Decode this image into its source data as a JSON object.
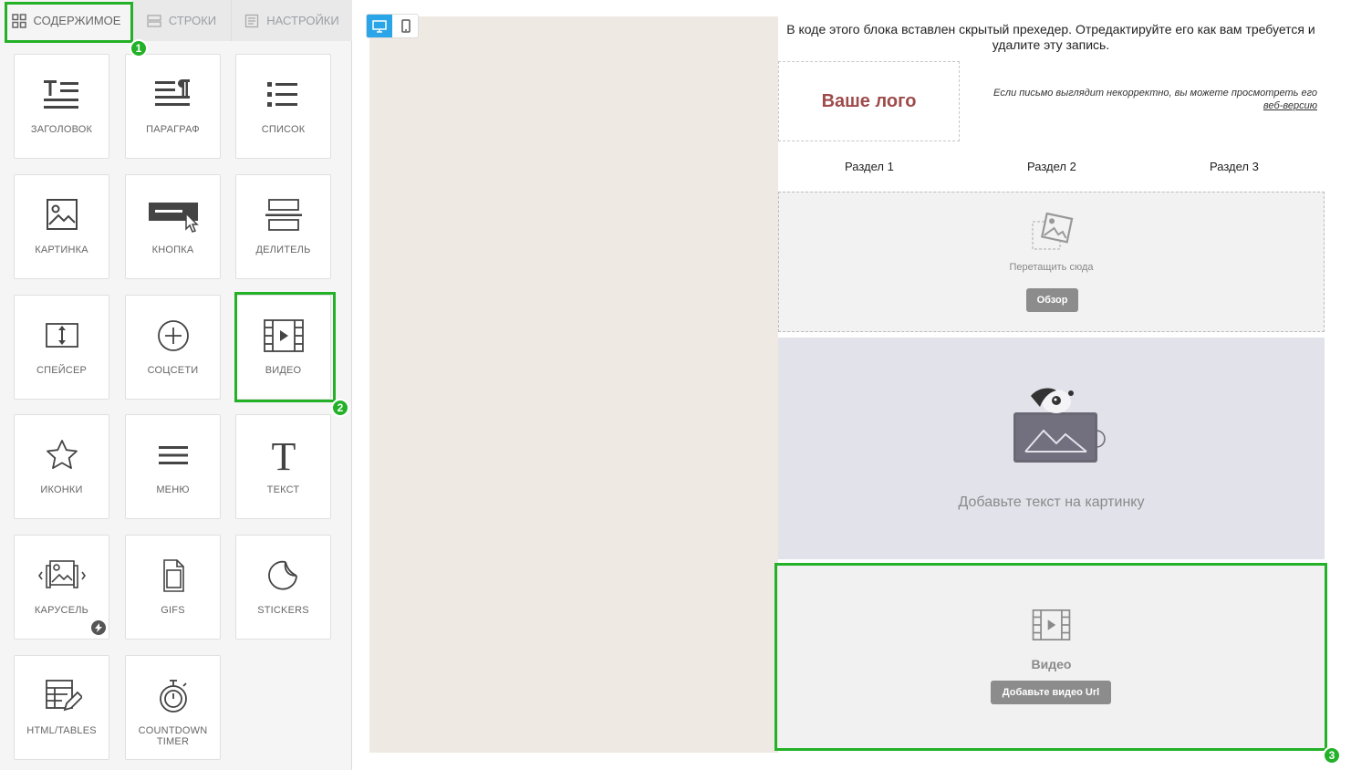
{
  "tabs": [
    {
      "label": "СОДЕРЖИМОЕ",
      "icon": "grid-icon",
      "active": true
    },
    {
      "label": "СТРОКИ",
      "icon": "rows-icon",
      "active": false
    },
    {
      "label": "НАСТРОЙКИ",
      "icon": "settings-icon",
      "active": false
    }
  ],
  "tiles": [
    {
      "label": "ЗАГОЛОВОК",
      "icon": "title-icon"
    },
    {
      "label": "ПАРАГРАФ",
      "icon": "paragraph-icon"
    },
    {
      "label": "СПИСОК",
      "icon": "list-icon"
    },
    {
      "label": "КАРТИНКА",
      "icon": "image-icon"
    },
    {
      "label": "КНОПКА",
      "icon": "button-icon"
    },
    {
      "label": "ДЕЛИТЕЛЬ",
      "icon": "divider-icon"
    },
    {
      "label": "СПЕЙСЕР",
      "icon": "spacer-icon"
    },
    {
      "label": "СОЦСЕТИ",
      "icon": "social-icon"
    },
    {
      "label": "ВИДЕО",
      "icon": "video-icon"
    },
    {
      "label": "ИКОНКИ",
      "icon": "star-icon"
    },
    {
      "label": "МЕНЮ",
      "icon": "menu-icon"
    },
    {
      "label": "ТЕКСТ",
      "icon": "text-icon"
    },
    {
      "label": "КАРУСЕЛЬ",
      "icon": "carousel-icon"
    },
    {
      "label": "GIFS",
      "icon": "gif-icon"
    },
    {
      "label": "STICKERS",
      "icon": "sticker-icon"
    },
    {
      "label": "HTML/TABLES",
      "icon": "html-tables-icon"
    },
    {
      "label": "COUNTDOWN TIMER",
      "icon": "timer-icon"
    }
  ],
  "annotations": [
    "1",
    "2",
    "3"
  ],
  "annotation_color": "#23b128",
  "device_toggle": {
    "active": "desktop",
    "options": [
      "desktop-icon",
      "mobile-icon"
    ],
    "accent": "#2aa6e8"
  },
  "email": {
    "preheader": "В коде этого блока вставлен скрытый прехедер. Отредактируйте его как вам требуется и удалите эту запись.",
    "logo": "Ваше лого",
    "webversion_text": "Если письмо выглядит некорректно, вы можете просмотреть его",
    "webversion_link": "веб-версию",
    "nav": [
      "Раздел 1",
      "Раздел 2",
      "Раздел 3"
    ],
    "image_drop": {
      "text": "Перетащить сюда",
      "button": "Обзор"
    },
    "bg_image_text": "Добавьте текст на картинку",
    "video": {
      "title": "Видео",
      "button": "Добавьте видео Url"
    }
  }
}
